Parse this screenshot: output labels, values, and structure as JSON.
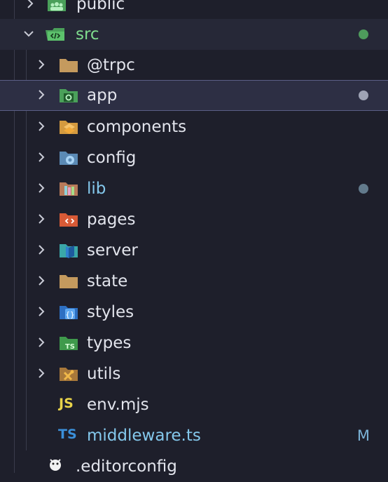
{
  "tree": {
    "public": {
      "label": "public"
    },
    "src": {
      "label": "src",
      "status_color": "#4e9b5c"
    },
    "children": [
      {
        "label": "@trpc",
        "icon": "folder-icon"
      },
      {
        "label": "app",
        "icon": "folder-app-icon",
        "status_color": "#9ea3b5"
      },
      {
        "label": "components",
        "icon": "folder-components-icon"
      },
      {
        "label": "config",
        "icon": "folder-config-icon"
      },
      {
        "label": "lib",
        "icon": "folder-lib-icon",
        "status_color": "#627a8c"
      },
      {
        "label": "pages",
        "icon": "folder-pages-icon"
      },
      {
        "label": "server",
        "icon": "folder-server-icon"
      },
      {
        "label": "state",
        "icon": "folder-icon"
      },
      {
        "label": "styles",
        "icon": "folder-styles-icon"
      },
      {
        "label": "types",
        "icon": "folder-types-icon"
      },
      {
        "label": "utils",
        "icon": "folder-utils-icon"
      }
    ],
    "files": [
      {
        "label": "env.mjs",
        "icon_text": "JS"
      },
      {
        "label": "middleware.ts",
        "icon_text": "TS",
        "git_status": "M"
      }
    ],
    "editorconfig": {
      "label": ".editorconfig"
    }
  }
}
